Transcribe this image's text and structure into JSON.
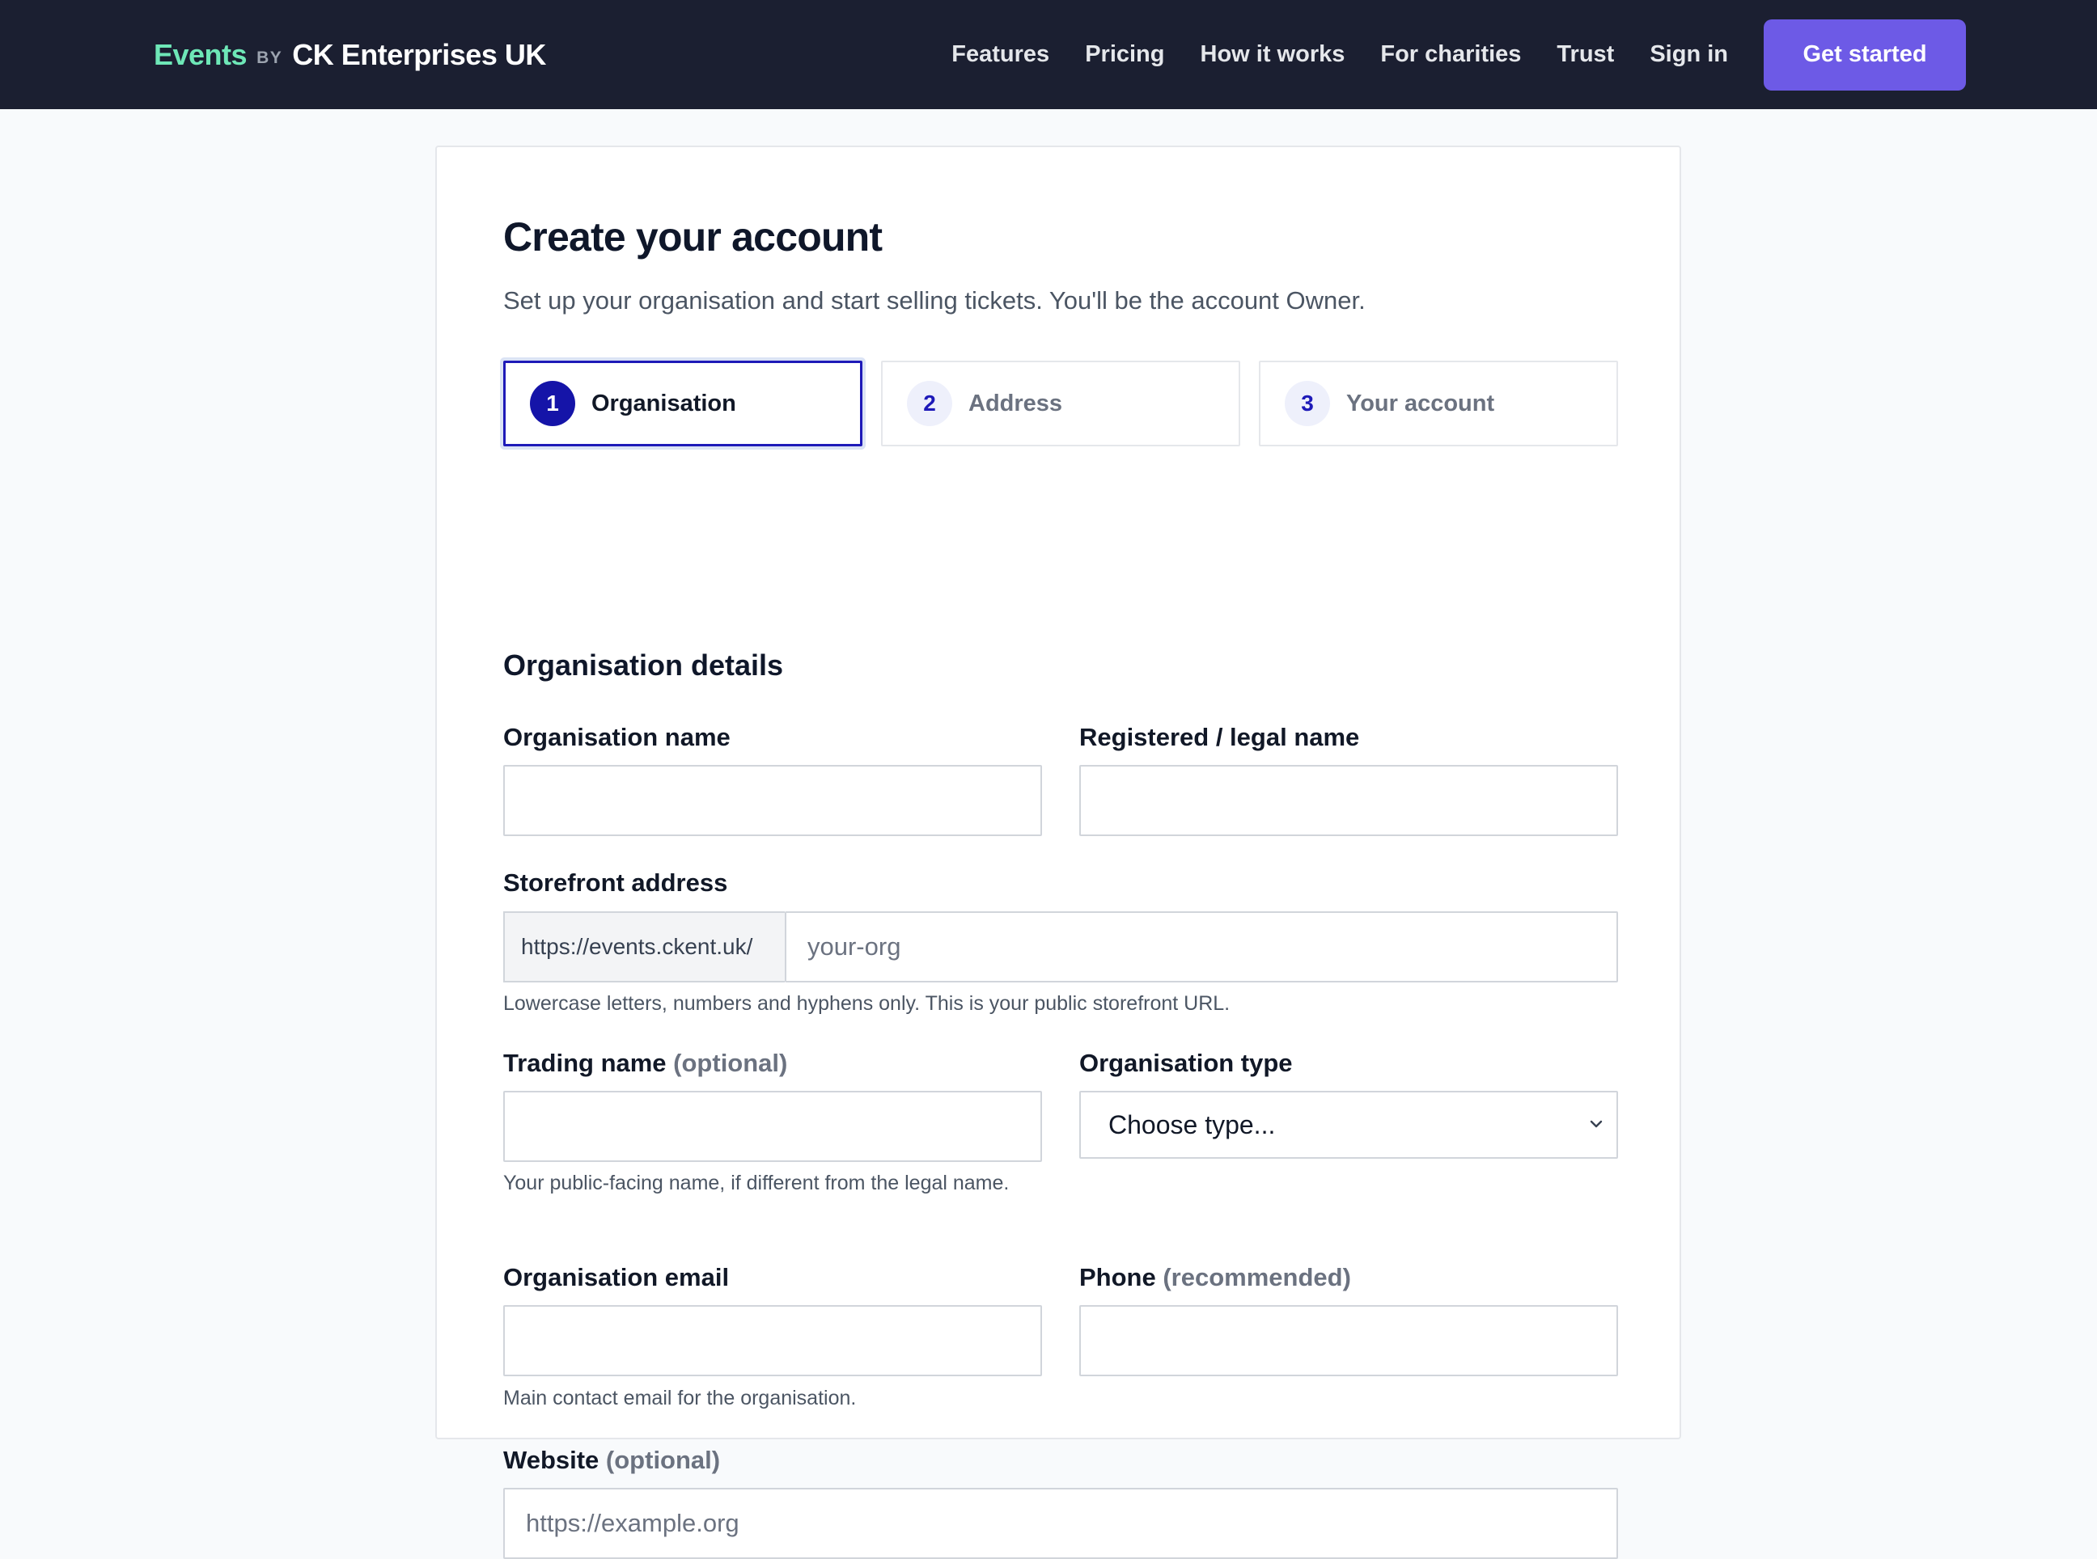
{
  "brand": {
    "events": "Events",
    "by": "BY",
    "company": "CK Enterprises UK"
  },
  "nav": {
    "links": [
      "Features",
      "Pricing",
      "How it works",
      "For charities",
      "Trust",
      "Sign in"
    ],
    "cta": "Get started"
  },
  "page": {
    "title": "Create your account",
    "subtitle": "Set up your organisation and start selling tickets. You'll be the account Owner."
  },
  "steps": [
    {
      "num": "1",
      "label": "Organisation",
      "active": true
    },
    {
      "num": "2",
      "label": "Address",
      "active": false
    },
    {
      "num": "3",
      "label": "Your account",
      "active": false
    }
  ],
  "form": {
    "section_title": "Organisation details",
    "org_name": {
      "label": "Organisation name",
      "value": ""
    },
    "legal_name": {
      "label": "Registered / legal name",
      "value": ""
    },
    "storefront": {
      "label": "Storefront address",
      "prefix": "https://events.ckent.uk/",
      "placeholder": "your-org",
      "hint": "Lowercase letters, numbers and hyphens only. This is your public storefront URL."
    },
    "trading_name": {
      "label": "Trading name",
      "optional": "(optional)",
      "value": "",
      "hint": "Your public-facing name, if different from the legal name."
    },
    "org_type": {
      "label": "Organisation type",
      "selected": "Choose type..."
    },
    "org_email": {
      "label": "Organisation email",
      "value": "",
      "hint": "Main contact email for the organisation."
    },
    "phone": {
      "label": "Phone",
      "optional": "(recommended)",
      "value": ""
    },
    "website": {
      "label": "Website",
      "optional": "(optional)",
      "placeholder": "https://example.org"
    }
  },
  "colors": {
    "nav_bg": "#1b1f31",
    "brand_accent": "#6ee7b7",
    "cta": "#6d5ae6",
    "step_active": "#1514a8"
  }
}
